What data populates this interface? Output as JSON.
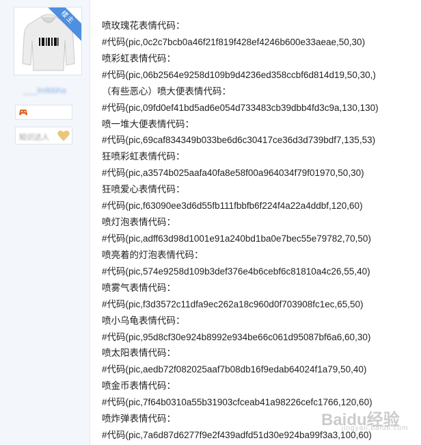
{
  "sidebar": {
    "corner_label": "楼主",
    "username": "___lmlbbha",
    "level_text": "知识达人"
  },
  "lines": [
    {
      "label": "喷玫瑰花表情代码：",
      "code": "#代码(pic,0c2c7bcb0a46f21f819f428ef4246b600e33aeae,50,30)"
    },
    {
      "label": "喷彩虹表情代码：",
      "code": "#代码(pic,06b2564e9258d109b9d4236ed358ccbf6d814d19,50,30,)"
    },
    {
      "label": "（有些恶心）喷大便表情代码：",
      "code": "#代码(pic,09fd0ef41bd5ad6e054d733483cb39dbb4fd3c9a,130,130)"
    },
    {
      "label": "喷一堆大便表情代码：",
      "code": "#代码(pic,69caf834349b033be6d6c30417ce36d3d739bdf7,135,53)"
    },
    {
      "label": "狂喷彩虹表情代码：",
      "code": "#代码(pic,a3574b025aafa40fa8e58f00a964034f79f01970,50,30)"
    },
    {
      "label": "狂喷爱心表情代码：",
      "code": "#代码(pic,f63090ee3d6d55fb111fbbfb6f224f4a22a4ddbf,120,60)"
    },
    {
      "label": "喷灯泡表情代码：",
      "code": "#代码(pic,adff63d98d1001e91a240bd1ba0e7bec55e79782,70,50)"
    },
    {
      "label": "喷亮着的灯泡表情代码：",
      "code": "#代码(pic,574e9258d109b3def376e4b6cebf6c81810a4c26,55,40)"
    },
    {
      "label": "喷雾气表情代码：",
      "code": "#代码(pic,f3d3572c11dfa9ec262a18c960d0f703908fc1ec,65,50)"
    },
    {
      "label": "喷小乌龟表情代码：",
      "code": "#代码(pic,95d8cf30e924b8992e934be66c061d95087bf6a6,60,30)"
    },
    {
      "label": "喷太阳表情代码：",
      "code": "#代码(pic,aedb72f082025aaf7b08db16f9edab64024f1a79,50,40)"
    },
    {
      "label": "喷金币表情代码：",
      "code": "#代码(pic,7f64b0310a55b31903cfceab41a98226cefc1766,120,60)"
    },
    {
      "label": "喷炸弹表情代码：",
      "code": "#代码(pic,7a6d87d6277f9e2f439adfd51d30e924ba99f3a3,100,60)"
    }
  ],
  "watermark": {
    "main": "Baidu经验",
    "sub": "jingyan.baidu.com"
  },
  "colors": {
    "sidebar_bg": "#f3f6fb",
    "corner_badge": "#4e8fe0",
    "text": "#222222"
  },
  "icons": {
    "avatar": "hoodie-image",
    "badge": "game-controller-icon",
    "level": "heart-icon"
  }
}
